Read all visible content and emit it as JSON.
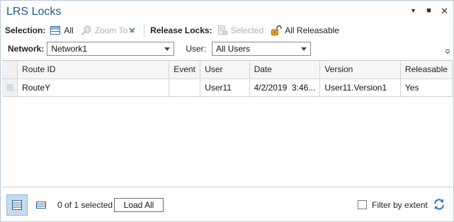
{
  "window": {
    "title": "LRS Locks",
    "controls": {
      "menu": "▼",
      "maximize": "■",
      "close": "✕"
    }
  },
  "toolbar": {
    "selection_label": "Selection:",
    "select_all_label": "All",
    "zoom_to_label": "Zoom To",
    "release_locks_label": "Release Locks:",
    "release_selected_label": "Selected",
    "release_all_label": "All Releasable"
  },
  "filters": {
    "network_label": "Network:",
    "network_value": "Network1",
    "user_label": "User:",
    "user_value": "All Users"
  },
  "table": {
    "columns": [
      "Route ID",
      "Event",
      "User",
      "Date",
      "Version",
      "Releasable"
    ],
    "rows": [
      {
        "route_id": "RouteY",
        "event": "",
        "user": "User11",
        "date": "4/2/2019  3:46...",
        "version": "User11.Version1",
        "releasable": "Yes"
      }
    ]
  },
  "footer": {
    "selected_count": "0 of 1 selected",
    "load_all_label": "Load All",
    "filter_by_extent_label": "Filter by extent",
    "filter_by_extent_checked": false
  },
  "colors": {
    "title": "#1a5a8a",
    "accent": "#2a7cc7",
    "disabled": "#a8b2bc",
    "active_view": "#c7dbee"
  },
  "icons": {
    "select_all": "table-select-icon",
    "zoom_to": "zoom-to-icon",
    "release_selected": "release-selected-icon",
    "release_all": "unlock-icon",
    "table_view": "table-view-icon",
    "list_view": "list-view-icon",
    "refresh": "refresh-icon"
  }
}
